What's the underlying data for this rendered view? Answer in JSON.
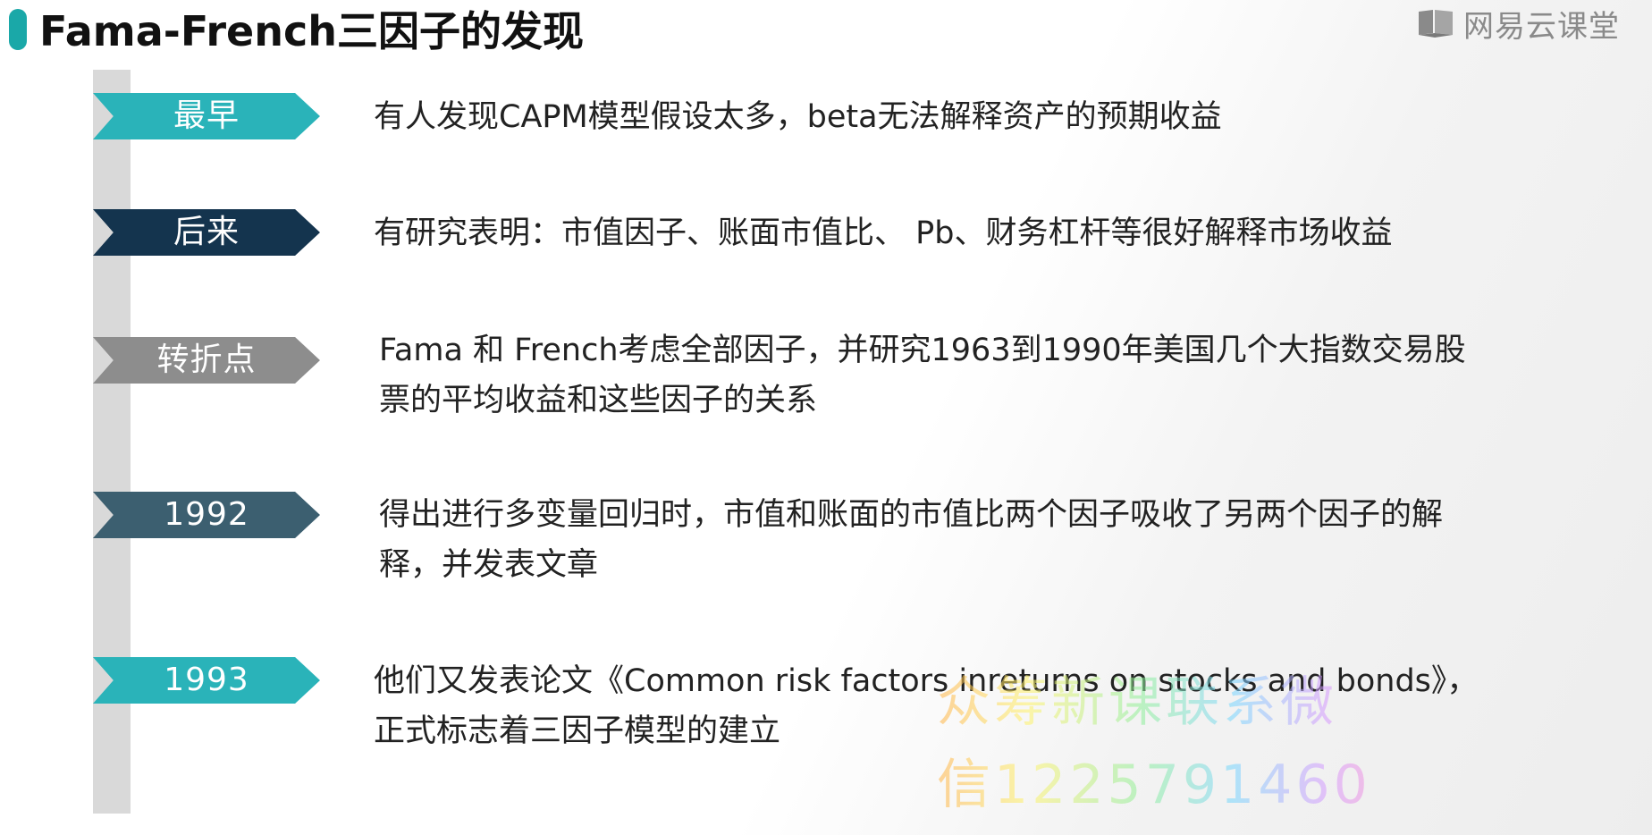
{
  "slide": {
    "title": "Fama-French三因子的发现",
    "logo_text": "网易云课堂",
    "logo_icon": "book-icon",
    "accent_color": "#1aa8a8"
  },
  "timeline": [
    {
      "tag": "最早",
      "color": "#2ab3b9",
      "lines": [
        "有人发现CAPM模型假设太多，beta无法解释资产的预期收益"
      ]
    },
    {
      "tag": "后来",
      "color": "#14344e",
      "lines": [
        "有研究表明：市值因子、账面市值比、 Pb、财务杠杆等很好解释市场收益"
      ]
    },
    {
      "tag": "转折点",
      "color": "#8d8d8d",
      "lines": [
        "Fama 和 French考虑全部因子，并研究1963到1990年美国几个大指数交易股",
        "票的平均收益和这些因子的关系"
      ]
    },
    {
      "tag": "1992",
      "color": "#3c5f70",
      "lines": [
        "得出进行多变量回归时，市值和账面的市值比两个因子吸收了另两个因子的解",
        "释，并发表文章"
      ]
    },
    {
      "tag": "1993",
      "color": "#2ab3b9",
      "lines": [
        "他们又发表论文《Common risk factors inreturns on stocks and bonds》，",
        "正式标志着三因子模型的建立"
      ]
    }
  ],
  "watermark": "众筹新课联系微信1225791460"
}
